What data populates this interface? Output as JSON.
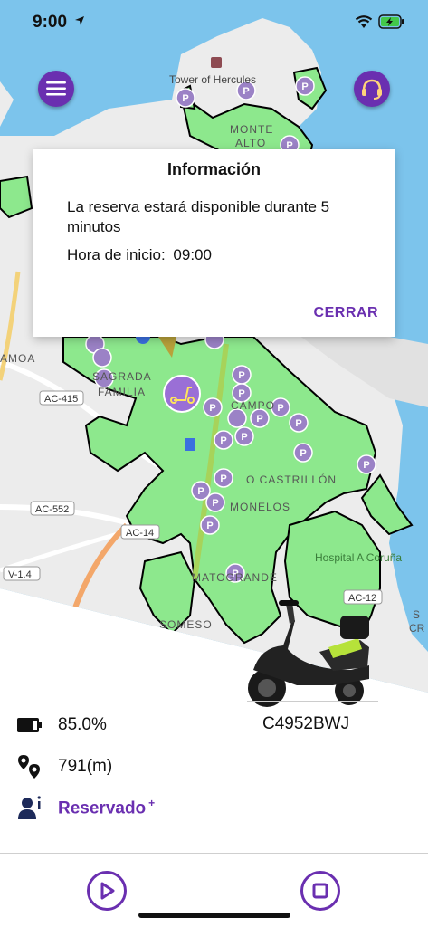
{
  "status_bar": {
    "time": "9:00"
  },
  "map": {
    "labels": {
      "tower": "Tower of Hercules",
      "monte_alto_1": "MONTE",
      "monte_alto_2": "ALTO",
      "sagrada_1": "SAGRADA",
      "sagrada_2": "FAMILIA",
      "amoa": "AMOA",
      "castrillon": "O CASTRILLÓN",
      "monelos": "MONELOS",
      "matogrande": "MATOGRANDE",
      "someso": "SOMESO",
      "hospital": "Hospital A Coruña",
      "campo": "CAMPO",
      "cs": "S",
      "cr": "CR",
      "ac415": "AC-415",
      "ac552": "AC-552",
      "ac14": "AC-14",
      "v14": "V-1.4",
      "ac12": "AC-12",
      "parking": "P"
    }
  },
  "buttons": {
    "menu": "menu-icon",
    "support": "headset-icon"
  },
  "dialog": {
    "title": "Información",
    "message": "La reserva estará disponible durante 5 minutos",
    "start_label": "Hora de inicio:",
    "start_value": "09:00",
    "close_label": "CERRAR"
  },
  "vehicle": {
    "plate": "C4952BWJ",
    "battery": "85.0%",
    "distance": "791(m)",
    "status": "Reservado",
    "status_mark": "+"
  },
  "colors": {
    "accent": "#6a2fb0",
    "zone_green": "#8de88d",
    "water": "#7cc4ec",
    "land": "#ececec"
  }
}
